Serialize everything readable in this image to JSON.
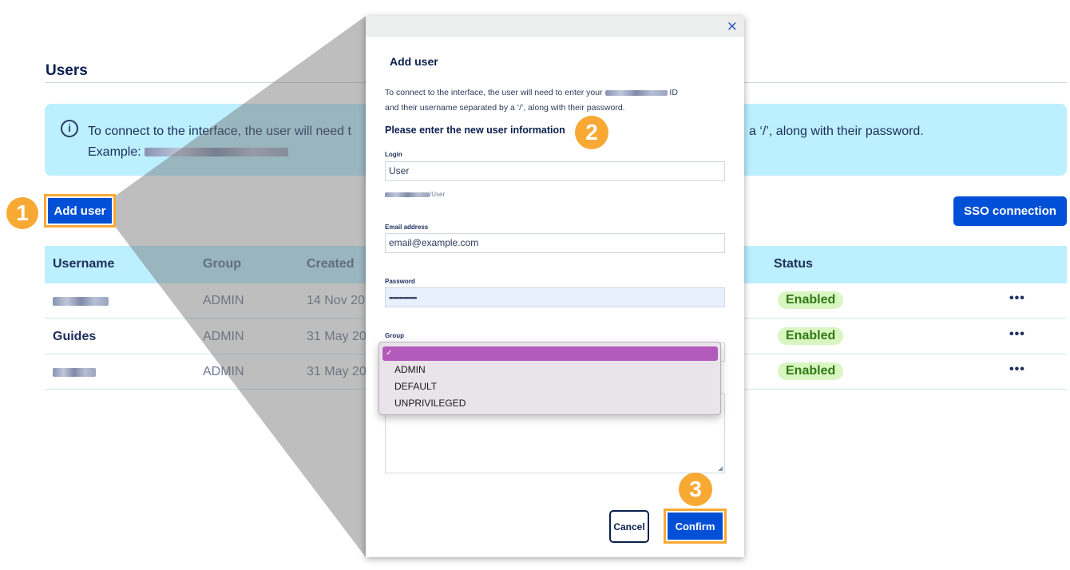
{
  "page": {
    "title": "Users",
    "info": {
      "text_start": "To connect to the interface, the user will need t",
      "text_end": "a ‘/’, along with their password.",
      "example_label": "Example:"
    },
    "add_user_label": "Add user",
    "sso_label": "SSO connection",
    "table": {
      "headers": {
        "username": "Username",
        "group": "Group",
        "created": "Created",
        "status": "Status"
      },
      "rows": [
        {
          "username": "",
          "group": "ADMIN",
          "created": "14 Nov 20",
          "status": "Enabled",
          "actions": "•••"
        },
        {
          "username": "Guides",
          "group": "ADMIN",
          "created": "31 May 20",
          "status": "Enabled",
          "actions": "•••"
        },
        {
          "username": "",
          "group": "ADMIN",
          "created": "31 May 20",
          "status": "Enabled",
          "actions": "•••"
        }
      ]
    }
  },
  "steps": [
    "1",
    "2",
    "3"
  ],
  "modal": {
    "close": "×",
    "title": "Add user",
    "desc_line1_start": "To connect to the interface, the user will need to enter your",
    "desc_line1_end": "ID",
    "desc_line2": "and their username separated by a ‘/’, along with their password.",
    "subtitle": "Please enter the new user information",
    "login_label": "Login",
    "login_value": "User",
    "login_hint_suffix": "/User",
    "email_label": "Email address",
    "email_value": "email@example.com",
    "password_label": "Password",
    "password_value": "••••••••••••••••",
    "group_label": "Group",
    "group_options": [
      {
        "label": "✓",
        "selected": true
      },
      {
        "label": "ADMIN"
      },
      {
        "label": "DEFAULT"
      },
      {
        "label": "UNPRIVILEGED"
      }
    ],
    "cancel_label": "Cancel",
    "confirm_label": "Confirm"
  },
  "colors": {
    "primary": "#0050d7",
    "highlight": "#f7a934",
    "banner": "#bcefff",
    "status_bg": "#d9f5c2",
    "status_text": "#2f7a13",
    "dropdown_selected": "#b35abd"
  },
  "icons": {
    "info": "info-circle-icon",
    "close": "close-icon"
  }
}
